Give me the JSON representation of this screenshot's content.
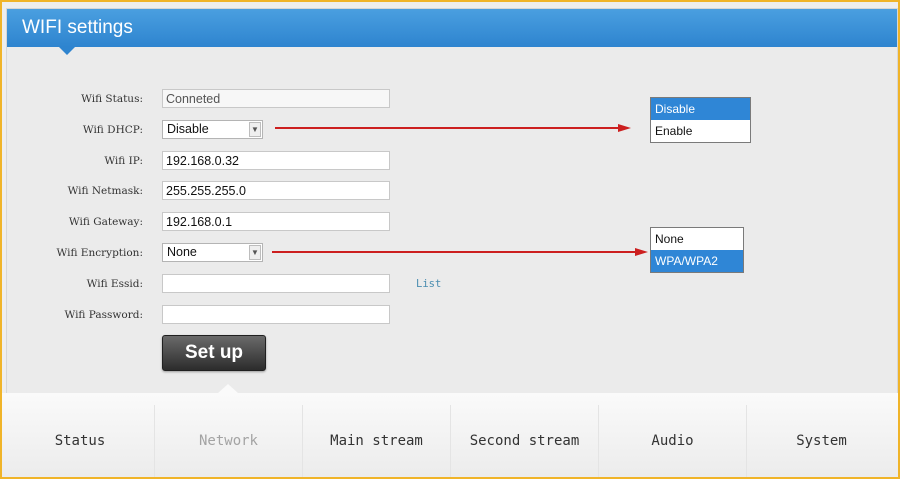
{
  "header": {
    "title": "WIFI settings"
  },
  "form": {
    "status": {
      "label": "Wifi Status:",
      "value": "Conneted"
    },
    "dhcp": {
      "label": "Wifi DHCP:",
      "value": "Disable",
      "options": [
        "Disable",
        "Enable"
      ]
    },
    "ip": {
      "label": "Wifi IP:",
      "value": "192.168.0.32"
    },
    "netmask": {
      "label": "Wifi Netmask:",
      "value": "255.255.255.0"
    },
    "gateway": {
      "label": "Wifi Gateway:",
      "value": "192.168.0.1"
    },
    "encryption": {
      "label": "Wifi Encryption:",
      "value": "None",
      "options": [
        "None",
        "WPA/WPA2"
      ]
    },
    "essid": {
      "label": "Wifi Essid:",
      "value": "",
      "list_label": "List"
    },
    "password": {
      "label": "Wifi Password:",
      "value": ""
    },
    "setup_label": "Set up"
  },
  "tabs": [
    {
      "label": "Status"
    },
    {
      "label": "Network"
    },
    {
      "label": "Main stream"
    },
    {
      "label": "Second stream"
    },
    {
      "label": "Audio"
    },
    {
      "label": "System"
    }
  ],
  "colors": {
    "header_blue": "#2e84cf",
    "selected_option": "#2f86d6",
    "annotation_arrow": "#cc1f1f",
    "frame_border": "#f0b429"
  }
}
